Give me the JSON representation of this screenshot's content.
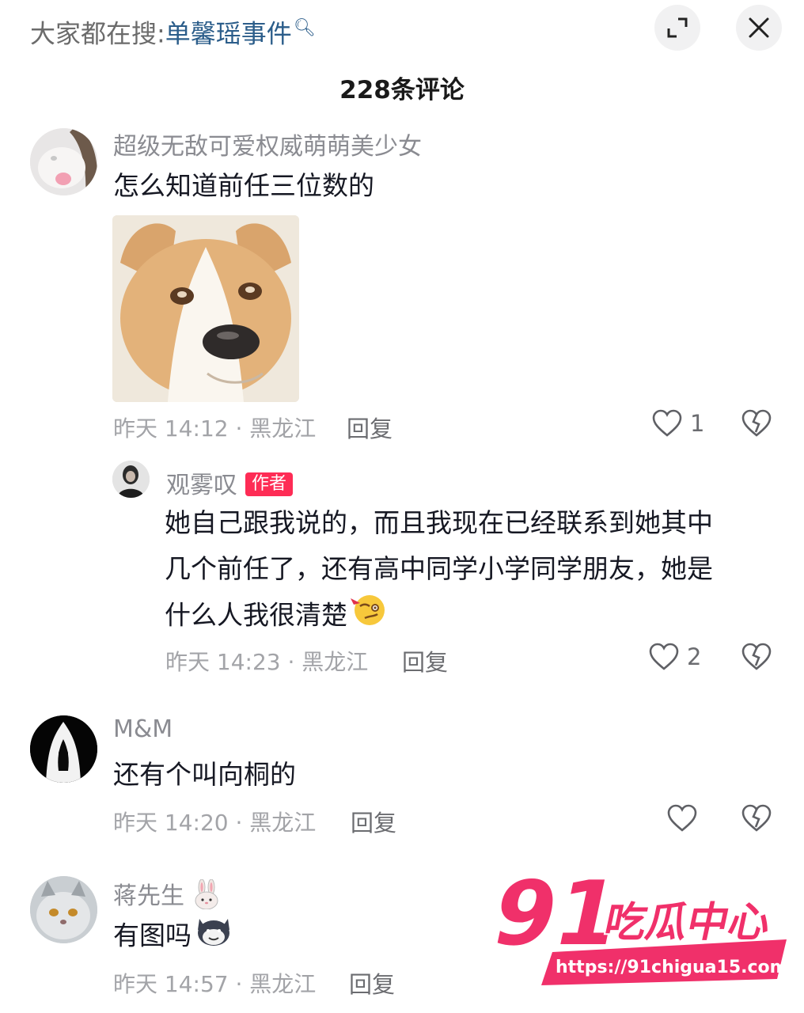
{
  "search": {
    "prefix": "大家都在搜:",
    "term": "单馨瑶事件",
    "icon": "search-icon"
  },
  "header": {
    "count_label": "228条评论",
    "expand_icon": "expand-icon",
    "close_icon": "close-icon"
  },
  "comments": [
    {
      "username": "超级无敌可爱权威萌萌美少女",
      "text": "怎么知道前任三位数的",
      "has_sticker": true,
      "meta": "昨天 14:12 · 黑龙江",
      "reply_label": "回复",
      "likes": "1"
    },
    {
      "username": "观雾叹",
      "badge": "作者",
      "text_lines": [
        "她自己跟我说的，而且我现在已经联系到她其中",
        "几个前任了，还有高中同学小学同学朋友，她是",
        "什么人我很清楚"
      ],
      "meta": "昨天 14:23 · 黑龙江",
      "reply_label": "回复",
      "likes": "2"
    },
    {
      "username": "M&M",
      "text": "还有个叫向桐的",
      "meta": "昨天 14:20 · 黑龙江",
      "reply_label": "回复",
      "likes": ""
    },
    {
      "username": "蒋先生",
      "text": "有图吗",
      "meta": "昨天 14:57 · 黑龙江",
      "reply_label": "回复",
      "likes": ""
    }
  ],
  "watermark": {
    "number": "91",
    "title": "吃瓜中心",
    "url": "https://91chigua15.com"
  },
  "colors": {
    "accent_red": "#fe2c55",
    "search_blue": "#2b5d8a",
    "watermark_pink": "#f0306a"
  }
}
